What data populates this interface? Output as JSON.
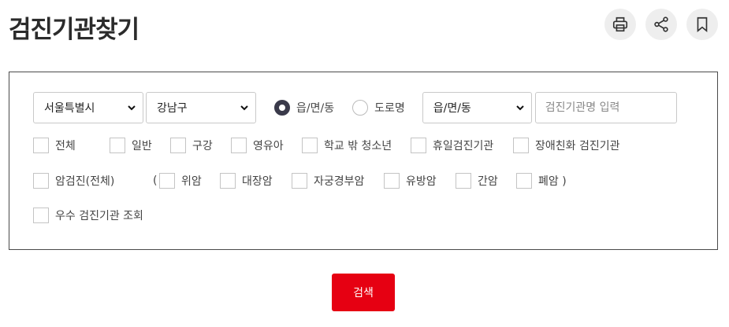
{
  "page": {
    "title": "검진기관찾기"
  },
  "actions": {
    "print": "print-icon",
    "share": "share-icon",
    "bookmark": "bookmark-icon"
  },
  "filters": {
    "city_select": "서울특별시",
    "district_select": "강남구",
    "radio_town": "읍/면/동",
    "radio_road": "도로명",
    "town_select": "읍/면/동",
    "name_placeholder": "검진기관명 입력"
  },
  "checkboxes_row1": [
    "전체",
    "일반",
    "구강",
    "영유아",
    "학교 밖 청소년",
    "휴일검진기관",
    "장애친화 검진기관"
  ],
  "cancer": {
    "all": "암검진(전체)",
    "open_paren": "(",
    "items": [
      "위암",
      "대장암",
      "자궁경부암",
      "유방암",
      "간암",
      "폐암 )"
    ]
  },
  "excellent": "우수 검진기관 조회",
  "search_button": "검색",
  "colors": {
    "accent": "#e60012",
    "radio_active": "#3a3a4a"
  }
}
